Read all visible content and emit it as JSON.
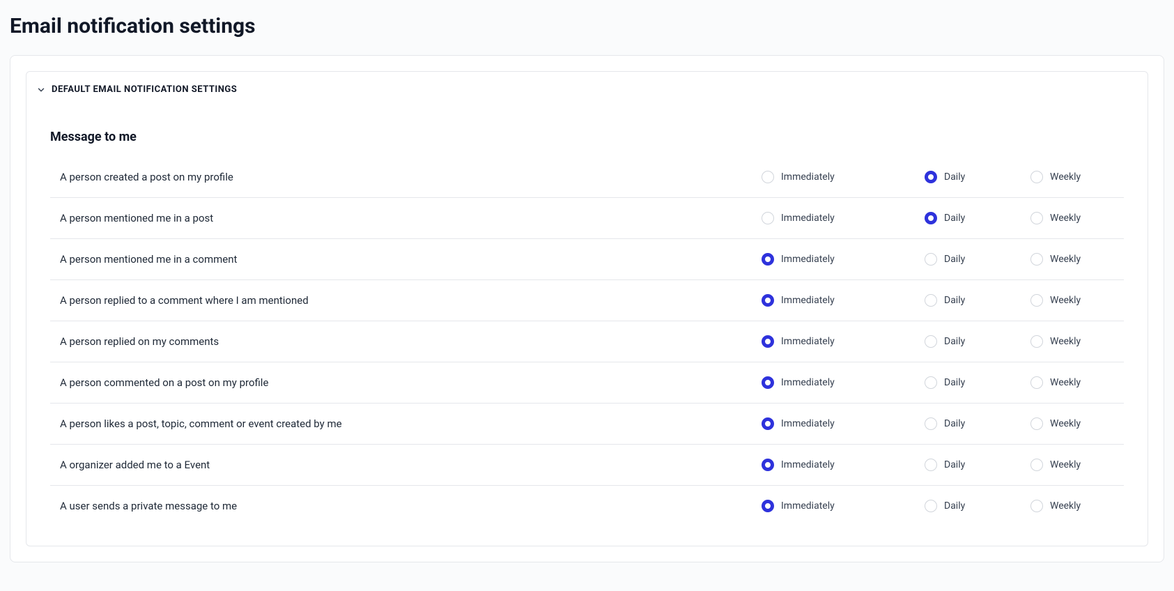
{
  "page": {
    "title": "Email notification settings"
  },
  "panel": {
    "title": "DEFAULT EMAIL NOTIFICATION SETTINGS"
  },
  "group": {
    "title": "Message to me"
  },
  "options": {
    "immediately": "Immediately",
    "daily": "Daily",
    "weekly": "Weekly"
  },
  "rows": [
    {
      "label": "A person created a post on my profile",
      "selected": "daily"
    },
    {
      "label": "A person mentioned me in a post",
      "selected": "daily"
    },
    {
      "label": "A person mentioned me in a comment",
      "selected": "immediately"
    },
    {
      "label": "A person replied to a comment where I am mentioned",
      "selected": "immediately"
    },
    {
      "label": "A person replied on my comments",
      "selected": "immediately"
    },
    {
      "label": "A person commented on a post on my profile",
      "selected": "immediately"
    },
    {
      "label": "A person likes a post, topic, comment or event created by me",
      "selected": "immediately"
    },
    {
      "label": "A organizer added me to a Event",
      "selected": "immediately"
    },
    {
      "label": "A user sends a private message to me",
      "selected": "immediately"
    }
  ]
}
